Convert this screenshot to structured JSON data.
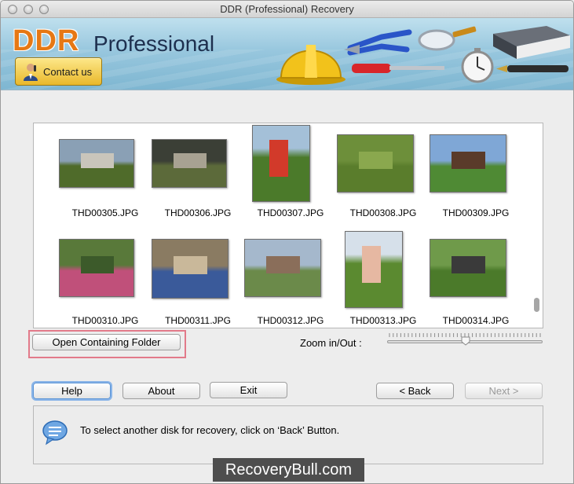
{
  "window": {
    "title": "DDR (Professional) Recovery"
  },
  "header": {
    "brand_ddr": "DDR",
    "brand_pro": "Professional",
    "contact_label": "Contact us",
    "icons": [
      "hard-hat-icon",
      "pliers-icon",
      "magnifier-icon",
      "book-icon",
      "screwdriver-icon",
      "stopwatch-icon",
      "pen-icon"
    ]
  },
  "thumbnails": [
    {
      "name": "THD00305.JPG",
      "scene": "building"
    },
    {
      "name": "THD00306.JPG",
      "scene": "dark-building"
    },
    {
      "name": "THD00307.JPG",
      "scene": "person-portrait"
    },
    {
      "name": "THD00308.JPG",
      "scene": "grass-field"
    },
    {
      "name": "THD00309.JPG",
      "scene": "houses-street"
    },
    {
      "name": "THD00310.JPG",
      "scene": "garden-flowers"
    },
    {
      "name": "THD00311.JPG",
      "scene": "bird"
    },
    {
      "name": "THD00312.JPG",
      "scene": "street-buildings"
    },
    {
      "name": "THD00313.JPG",
      "scene": "child-grass-portrait"
    },
    {
      "name": "THD00314.JPG",
      "scene": "park-people"
    }
  ],
  "actions": {
    "open_folder": "Open Containing Folder",
    "zoom_label": "Zoom in/Out :",
    "zoom_level": 0.5
  },
  "buttons": {
    "help": "Help",
    "about": "About",
    "exit": "Exit",
    "back": "< Back",
    "next": "Next >"
  },
  "status": {
    "message": "To select another disk for recovery, click on ‘Back’ Button."
  },
  "watermark": "RecoveryBull.com",
  "colors": {
    "banner": "#98c7de",
    "brand_orange": "#e67814",
    "highlight": "#e27a8a"
  }
}
